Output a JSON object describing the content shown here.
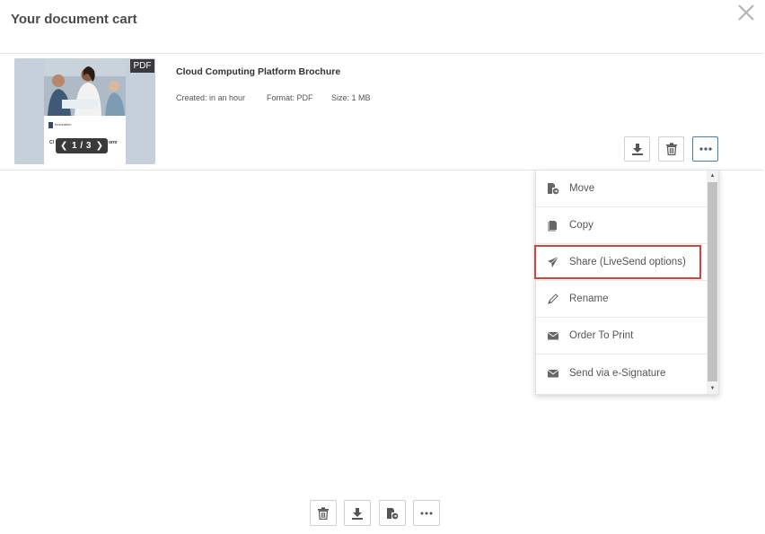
{
  "header": {
    "title": "Your document cart",
    "close_icon": "close-icon"
  },
  "document": {
    "badge": "PDF",
    "title": "Cloud Computing Platform Brochure",
    "created": "Created: in an hour",
    "format": "Format: PDF",
    "size": "Size: 1 MB",
    "page_counter": "1 / 3",
    "prev_glyph": "❮",
    "next_glyph": "❯",
    "thumb_logo_text": "Innovation",
    "thumb_caption_left": "Cl",
    "thumb_caption_right": "orm",
    "actions": [
      {
        "name": "download",
        "icon": "download-icon"
      },
      {
        "name": "delete",
        "icon": "trash-icon"
      },
      {
        "name": "more",
        "icon": "more-icon"
      }
    ]
  },
  "menu": {
    "items": [
      {
        "label": "Move",
        "icon": "move-file-icon"
      },
      {
        "label": "Copy",
        "icon": "copy-icon"
      },
      {
        "label": "Share (LiveSend options)",
        "icon": "send-icon"
      },
      {
        "label": "Rename",
        "icon": "pencil-icon"
      },
      {
        "label": "Order To Print",
        "icon": "envelope-icon"
      },
      {
        "label": "Send via e-Signature",
        "icon": "envelope-icon"
      }
    ],
    "highlighted_item": "Share (LiveSend options)"
  },
  "bottom_toolbar": {
    "buttons": [
      {
        "name": "delete-all",
        "icon": "trash-icon"
      },
      {
        "name": "download-all",
        "icon": "download-icon"
      },
      {
        "name": "move-all",
        "icon": "move-file-icon"
      },
      {
        "name": "more",
        "icon": "more-icon"
      }
    ]
  },
  "colors": {
    "accent_blue": "#3b83bd",
    "highlight_red": "#d9403d",
    "icon_gray": "#555555",
    "thumb_bg": "#c6d0dc"
  }
}
